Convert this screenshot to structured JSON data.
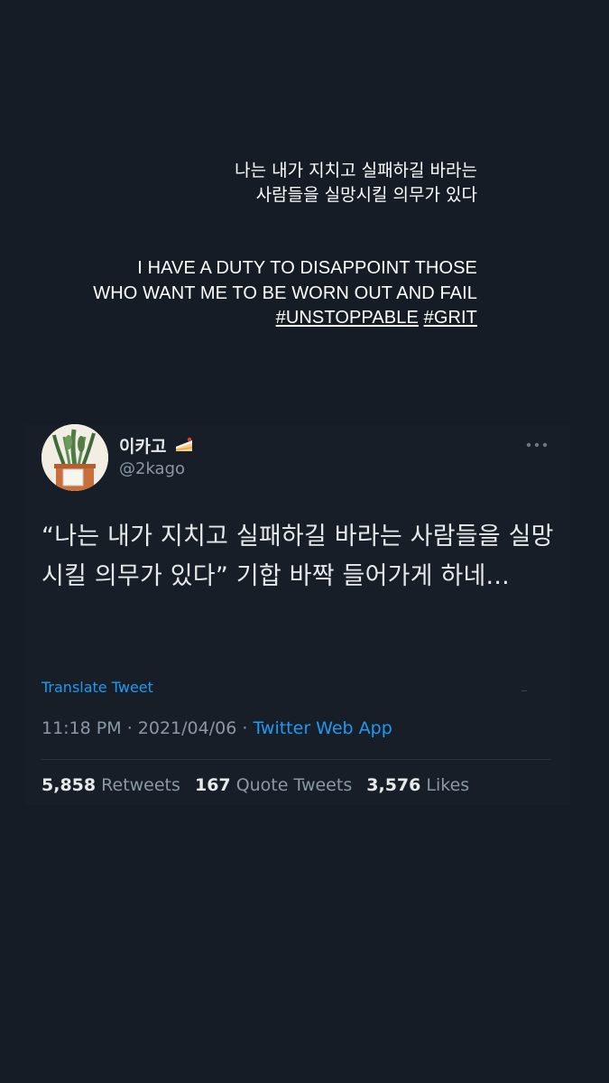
{
  "story": {
    "korean_lines": [
      "나는 내가 지치고 실패하길 바라는",
      "사람들을 실망시킬 의무가 있다"
    ],
    "english_lines": [
      "I HAVE A DUTY TO DISAPPOINT THOSE",
      "WHO WANT ME TO BE WORN OUT AND FAIL"
    ],
    "hashtags": [
      "#UNSTOPPABLE",
      "#GRIT"
    ]
  },
  "tweet": {
    "display_name": "이카고",
    "handle": "@2kago",
    "text": "“나는 내가 지치고 실패하길 바라는 사람들을 실망시킬 의무가 있다” 기합 바짝 들어가게 하네...",
    "translate_label": "Translate Tweet",
    "time": "11:18 PM",
    "date": "2021/04/06",
    "separator": "·",
    "source": "Twitter Web App",
    "stats": {
      "retweets_count": "5,858",
      "retweets_label": "Retweets",
      "quotes_count": "167",
      "quotes_label": "Quote Tweets",
      "likes_count": "3,576",
      "likes_label": "Likes"
    }
  },
  "icons": {
    "name_emoji": "cake-icon",
    "avatar_image": "potted-cactus-avatar",
    "more": "more-dots-icon"
  },
  "colors": {
    "background": "#161c25",
    "card": "#171e28",
    "link": "#1d9bf0",
    "secondary_text": "#8b98a5",
    "primary_text": "#e7e9ea"
  }
}
